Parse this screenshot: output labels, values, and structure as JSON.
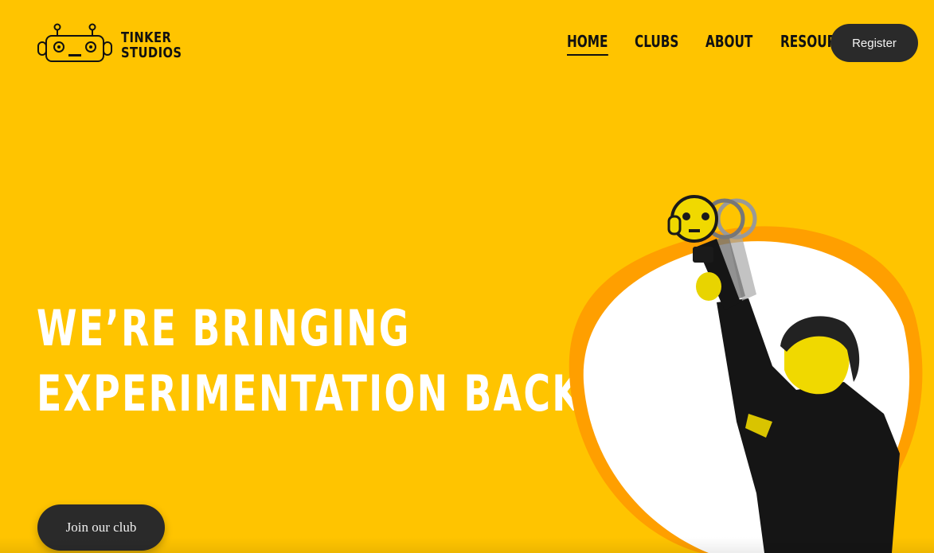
{
  "brand": {
    "line1": "TINKER",
    "line2": "STUDIOS",
    "accent_color": "#ffc400",
    "logo_icon": "robot-head-icon"
  },
  "nav": {
    "items": [
      {
        "label": "HOME",
        "active": true
      },
      {
        "label": "CLUBS",
        "active": false
      },
      {
        "label": "ABOUT",
        "active": false
      },
      {
        "label": "RESOURCES",
        "active": false
      }
    ],
    "register_label": "Register"
  },
  "hero": {
    "line1": "WE’RE BRINGING",
    "line2": "EXPERIMENTATION BACK",
    "cta_label": "Join our club",
    "image_icon": "child-with-toy-photo"
  }
}
